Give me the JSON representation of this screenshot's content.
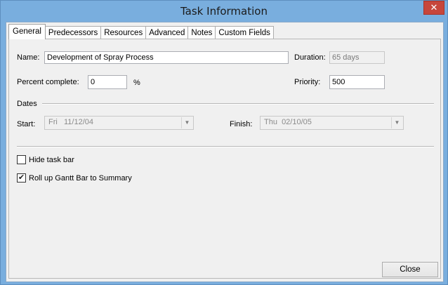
{
  "window": {
    "title": "Task Information",
    "close_glyph": "✕"
  },
  "tabs": [
    {
      "label": "General"
    },
    {
      "label": "Predecessors"
    },
    {
      "label": "Resources"
    },
    {
      "label": "Advanced"
    },
    {
      "label": "Notes"
    },
    {
      "label": "Custom Fields"
    }
  ],
  "general": {
    "name_label": "Name:",
    "name_value": "Development of Spray Process",
    "duration_label": "Duration:",
    "duration_value": "65 days",
    "percent_label": "Percent complete:",
    "percent_value": "0",
    "percent_unit": "%",
    "priority_label": "Priority:",
    "priority_value": "500",
    "dates_heading": "Dates",
    "start_label": "Start:",
    "start_value": "Fri   11/12/04",
    "finish_label": "Finish:",
    "finish_value": "Thu  02/10/05",
    "hide_taskbar_label": "Hide task bar",
    "hide_taskbar_checked": false,
    "rollup_label": "Roll up Gantt Bar to Summary",
    "rollup_checked": true,
    "rollup_check_glyph": "✔"
  },
  "footer": {
    "close_label": "Close"
  }
}
